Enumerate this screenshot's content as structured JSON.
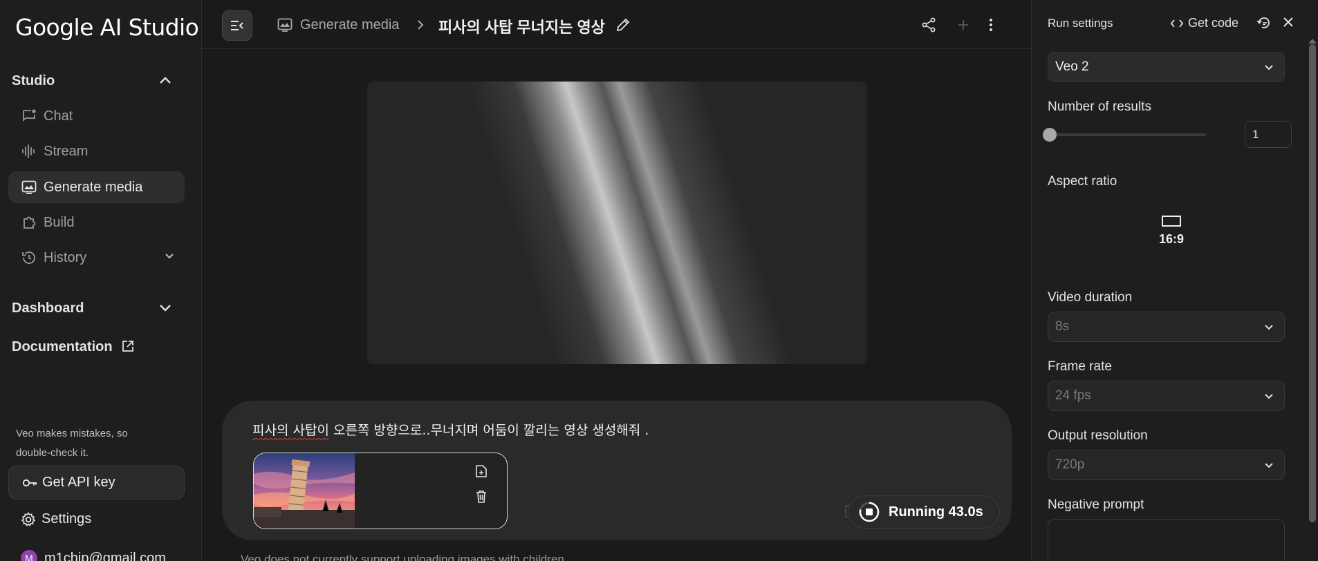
{
  "app": {
    "logo_text": "Google AI Studio"
  },
  "sidebar": {
    "studio_label": "Studio",
    "items": [
      {
        "label": "Chat",
        "icon": "chat-icon"
      },
      {
        "label": "Stream",
        "icon": "stream-icon"
      },
      {
        "label": "Generate media",
        "icon": "image-icon",
        "active": true
      },
      {
        "label": "Build",
        "icon": "build-icon"
      },
      {
        "label": "History",
        "icon": "history-icon"
      }
    ],
    "dashboard_label": "Dashboard",
    "documentation_label": "Documentation",
    "note": "Veo makes mistakes, so double-check it.",
    "api_key_label": "Get API key",
    "settings_label": "Settings",
    "account_email": "m1chip@gmail.com",
    "avatar_letter": "M"
  },
  "header": {
    "breadcrumb": "Generate media",
    "title": "피사의 사탑 무너지는 영상"
  },
  "prompt": {
    "text_underlined": "피사의 사탑이",
    "text_rest": " 오른쪽 방향으로..무너지며 어둠이 깔리는 영상 생성해줘 .",
    "run_label": "Running 43.0s"
  },
  "footnote": "Veo does not currently support uploading images with children.",
  "run_settings": {
    "title": "Run settings",
    "get_code_label": "Get code",
    "model": "Veo 2",
    "num_results_label": "Number of results",
    "num_results_value": "1",
    "num_results_slider": 0,
    "aspect_ratio_label": "Aspect ratio",
    "aspect_ratio_value": "16:9",
    "video_duration_label": "Video duration",
    "video_duration_value": "8s",
    "frame_rate_label": "Frame rate",
    "frame_rate_value": "24 fps",
    "output_resolution_label": "Output resolution",
    "output_resolution_value": "720p",
    "negative_prompt_label": "Negative prompt"
  },
  "colors": {
    "background": "#1a1a1a",
    "panel": "#1e1e1e",
    "active_item": "#2e2e2e",
    "avatar": "#8e44ad",
    "spellcheck": "#e53935"
  }
}
